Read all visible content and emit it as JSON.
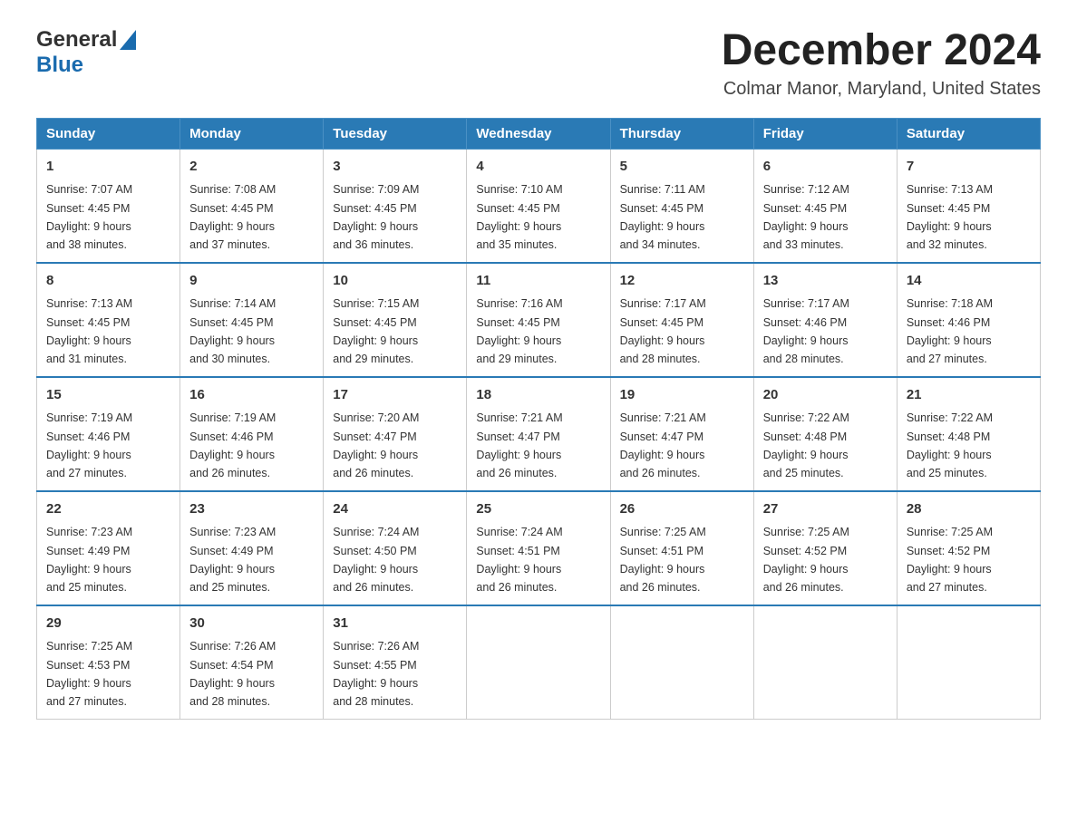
{
  "header": {
    "logo": {
      "general": "General",
      "blue": "Blue"
    },
    "month_title": "December 2024",
    "location": "Colmar Manor, Maryland, United States"
  },
  "days_of_week": [
    "Sunday",
    "Monday",
    "Tuesday",
    "Wednesday",
    "Thursday",
    "Friday",
    "Saturday"
  ],
  "weeks": [
    [
      {
        "day": "1",
        "sunrise": "7:07 AM",
        "sunset": "4:45 PM",
        "daylight": "9 hours and 38 minutes."
      },
      {
        "day": "2",
        "sunrise": "7:08 AM",
        "sunset": "4:45 PM",
        "daylight": "9 hours and 37 minutes."
      },
      {
        "day": "3",
        "sunrise": "7:09 AM",
        "sunset": "4:45 PM",
        "daylight": "9 hours and 36 minutes."
      },
      {
        "day": "4",
        "sunrise": "7:10 AM",
        "sunset": "4:45 PM",
        "daylight": "9 hours and 35 minutes."
      },
      {
        "day": "5",
        "sunrise": "7:11 AM",
        "sunset": "4:45 PM",
        "daylight": "9 hours and 34 minutes."
      },
      {
        "day": "6",
        "sunrise": "7:12 AM",
        "sunset": "4:45 PM",
        "daylight": "9 hours and 33 minutes."
      },
      {
        "day": "7",
        "sunrise": "7:13 AM",
        "sunset": "4:45 PM",
        "daylight": "9 hours and 32 minutes."
      }
    ],
    [
      {
        "day": "8",
        "sunrise": "7:13 AM",
        "sunset": "4:45 PM",
        "daylight": "9 hours and 31 minutes."
      },
      {
        "day": "9",
        "sunrise": "7:14 AM",
        "sunset": "4:45 PM",
        "daylight": "9 hours and 30 minutes."
      },
      {
        "day": "10",
        "sunrise": "7:15 AM",
        "sunset": "4:45 PM",
        "daylight": "9 hours and 29 minutes."
      },
      {
        "day": "11",
        "sunrise": "7:16 AM",
        "sunset": "4:45 PM",
        "daylight": "9 hours and 29 minutes."
      },
      {
        "day": "12",
        "sunrise": "7:17 AM",
        "sunset": "4:45 PM",
        "daylight": "9 hours and 28 minutes."
      },
      {
        "day": "13",
        "sunrise": "7:17 AM",
        "sunset": "4:46 PM",
        "daylight": "9 hours and 28 minutes."
      },
      {
        "day": "14",
        "sunrise": "7:18 AM",
        "sunset": "4:46 PM",
        "daylight": "9 hours and 27 minutes."
      }
    ],
    [
      {
        "day": "15",
        "sunrise": "7:19 AM",
        "sunset": "4:46 PM",
        "daylight": "9 hours and 27 minutes."
      },
      {
        "day": "16",
        "sunrise": "7:19 AM",
        "sunset": "4:46 PM",
        "daylight": "9 hours and 26 minutes."
      },
      {
        "day": "17",
        "sunrise": "7:20 AM",
        "sunset": "4:47 PM",
        "daylight": "9 hours and 26 minutes."
      },
      {
        "day": "18",
        "sunrise": "7:21 AM",
        "sunset": "4:47 PM",
        "daylight": "9 hours and 26 minutes."
      },
      {
        "day": "19",
        "sunrise": "7:21 AM",
        "sunset": "4:47 PM",
        "daylight": "9 hours and 26 minutes."
      },
      {
        "day": "20",
        "sunrise": "7:22 AM",
        "sunset": "4:48 PM",
        "daylight": "9 hours and 25 minutes."
      },
      {
        "day": "21",
        "sunrise": "7:22 AM",
        "sunset": "4:48 PM",
        "daylight": "9 hours and 25 minutes."
      }
    ],
    [
      {
        "day": "22",
        "sunrise": "7:23 AM",
        "sunset": "4:49 PM",
        "daylight": "9 hours and 25 minutes."
      },
      {
        "day": "23",
        "sunrise": "7:23 AM",
        "sunset": "4:49 PM",
        "daylight": "9 hours and 25 minutes."
      },
      {
        "day": "24",
        "sunrise": "7:24 AM",
        "sunset": "4:50 PM",
        "daylight": "9 hours and 26 minutes."
      },
      {
        "day": "25",
        "sunrise": "7:24 AM",
        "sunset": "4:51 PM",
        "daylight": "9 hours and 26 minutes."
      },
      {
        "day": "26",
        "sunrise": "7:25 AM",
        "sunset": "4:51 PM",
        "daylight": "9 hours and 26 minutes."
      },
      {
        "day": "27",
        "sunrise": "7:25 AM",
        "sunset": "4:52 PM",
        "daylight": "9 hours and 26 minutes."
      },
      {
        "day": "28",
        "sunrise": "7:25 AM",
        "sunset": "4:52 PM",
        "daylight": "9 hours and 27 minutes."
      }
    ],
    [
      {
        "day": "29",
        "sunrise": "7:25 AM",
        "sunset": "4:53 PM",
        "daylight": "9 hours and 27 minutes."
      },
      {
        "day": "30",
        "sunrise": "7:26 AM",
        "sunset": "4:54 PM",
        "daylight": "9 hours and 28 minutes."
      },
      {
        "day": "31",
        "sunrise": "7:26 AM",
        "sunset": "4:55 PM",
        "daylight": "9 hours and 28 minutes."
      },
      null,
      null,
      null,
      null
    ]
  ],
  "labels": {
    "sunrise": "Sunrise:",
    "sunset": "Sunset:",
    "daylight": "Daylight:"
  }
}
